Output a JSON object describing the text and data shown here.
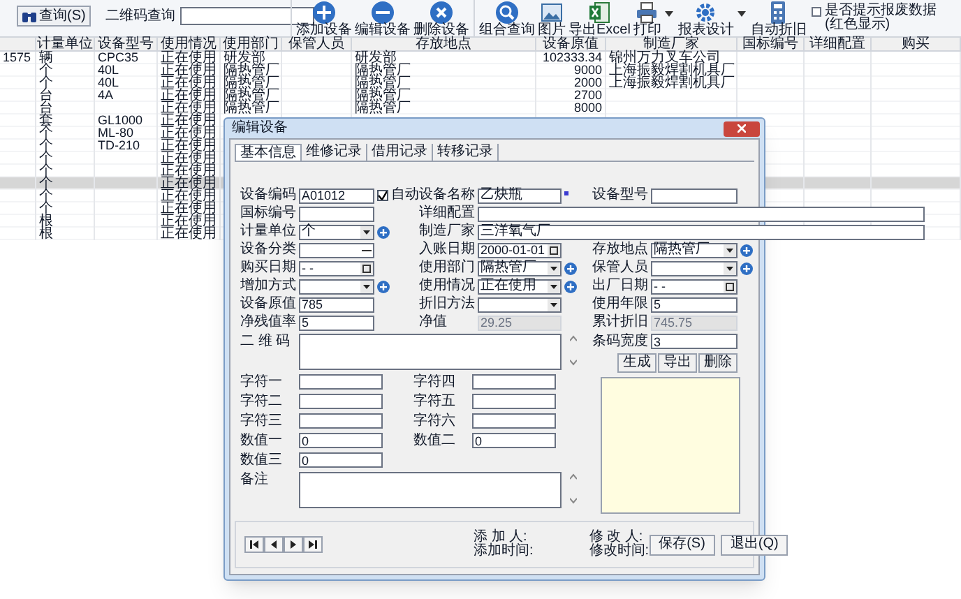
{
  "toolbar": {
    "query_button": "查询(S)",
    "qr_label": "二维码查询",
    "tools": [
      {
        "label": "添加设备",
        "kind": "add",
        "dropdown": false
      },
      {
        "label": "编辑设备",
        "kind": "edit",
        "dropdown": false
      },
      {
        "label": "删除设备",
        "kind": "delete",
        "dropdown": false
      },
      {
        "label": "组合查询",
        "kind": "search",
        "dropdown": false
      },
      {
        "label": "图片",
        "kind": "picture",
        "dropdown": false
      },
      {
        "label": "导出Excel",
        "kind": "excel",
        "dropdown": false
      },
      {
        "label": "打印",
        "kind": "print",
        "dropdown": true
      },
      {
        "label": "报表设计",
        "kind": "gear",
        "dropdown": true
      },
      {
        "label": "自动折旧",
        "kind": "calc",
        "dropdown": false
      }
    ],
    "warn_checkbox": {
      "label": "是否提示报废数据",
      "note": "(红色显示)",
      "checked": false
    }
  },
  "table": {
    "columns": [
      null,
      "计量单位",
      "设备型号",
      "使用情况",
      "使用部门",
      "保管人员",
      "存放地点",
      "设备原值",
      "制造厂家",
      "国标编号",
      "详细配置",
      "购买"
    ],
    "rows": [
      {
        "cells": [
          "1575",
          "辆",
          "CPC35",
          "正在使用",
          "研发部",
          null,
          "研发部",
          "102333.34",
          "锦州万力叉车公司",
          null,
          null,
          null
        ],
        "selected": false
      },
      {
        "cells": [
          null,
          "个",
          "40L",
          "正在使用",
          "隔热管厂",
          null,
          "隔热管厂",
          "9000",
          "上海振毅焊割机具厂",
          null,
          null,
          null
        ],
        "selected": false
      },
      {
        "cells": [
          null,
          "个",
          "40L",
          "正在使用",
          "隔热管厂",
          null,
          "隔热管厂",
          "2000",
          "上海振毅焊割机具厂",
          null,
          null,
          null
        ],
        "selected": false
      },
      {
        "cells": [
          null,
          "台",
          "4A",
          "正在使用",
          "隔热管厂",
          null,
          "隔热管厂",
          "2700",
          null,
          null,
          null,
          null
        ],
        "selected": false
      },
      {
        "cells": [
          null,
          "台",
          null,
          "正在使用",
          "隔热管厂",
          null,
          "隔热管厂",
          "8000",
          null,
          null,
          null,
          null
        ],
        "selected": false
      },
      {
        "cells": [
          null,
          "套",
          "GL1000",
          "正在使用",
          null,
          null,
          null,
          null,
          null,
          null,
          null,
          null
        ],
        "selected": false
      },
      {
        "cells": [
          null,
          "个",
          "ML-80",
          "正在使用",
          null,
          null,
          null,
          null,
          null,
          null,
          null,
          null
        ],
        "selected": false
      },
      {
        "cells": [
          null,
          "个",
          "TD-210",
          "正在使用",
          null,
          null,
          null,
          null,
          null,
          null,
          null,
          null
        ],
        "selected": false
      },
      {
        "cells": [
          null,
          "个",
          null,
          "正在使用",
          null,
          null,
          null,
          null,
          null,
          null,
          null,
          null
        ],
        "selected": false
      },
      {
        "cells": [
          null,
          "个",
          null,
          "正在使用",
          null,
          null,
          null,
          null,
          null,
          null,
          null,
          null
        ],
        "selected": false
      },
      {
        "cells": [
          null,
          "个",
          null,
          "正在使用",
          null,
          null,
          null,
          null,
          null,
          null,
          null,
          null
        ],
        "selected": true
      },
      {
        "cells": [
          null,
          "个",
          null,
          "正在使用",
          null,
          null,
          null,
          null,
          null,
          null,
          null,
          null
        ],
        "selected": false
      },
      {
        "cells": [
          null,
          "个",
          null,
          "正在使用",
          null,
          null,
          null,
          null,
          null,
          null,
          null,
          null
        ],
        "selected": false
      },
      {
        "cells": [
          null,
          "根",
          null,
          "正在使用",
          null,
          null,
          null,
          null,
          null,
          null,
          null,
          null
        ],
        "selected": false
      },
      {
        "cells": [
          null,
          "根",
          null,
          "正在使用",
          null,
          null,
          null,
          null,
          null,
          null,
          null,
          null
        ],
        "selected": false
      }
    ]
  },
  "dialog": {
    "title": "编辑设备",
    "tabs": [
      {
        "label": "基本信息",
        "selected": true
      },
      {
        "label": "维修记录",
        "selected": false
      },
      {
        "label": "借用记录",
        "selected": false
      },
      {
        "label": "转移记录",
        "selected": false
      }
    ],
    "form_rows": [
      [
        {
          "label": "设备编码",
          "value": "A01012",
          "kind": "text",
          "add": false,
          "disabled": false,
          "auto": {
            "label": "自动",
            "checked": true
          }
        },
        {
          "label": "设备名称",
          "value": "乙炔瓶",
          "kind": "text",
          "add": false,
          "disabled": false,
          "required": true
        },
        {
          "label": "设备型号",
          "kind": "text",
          "add": false,
          "disabled": false
        }
      ],
      [
        {
          "label": "国标编号",
          "kind": "text",
          "add": false,
          "disabled": false
        },
        {
          "label": "详细配置",
          "kind": "wide",
          "add": false,
          "disabled": false
        }
      ],
      [
        {
          "label": "计量单位",
          "value": "个",
          "kind": "combo",
          "add": true,
          "disabled": false
        },
        {
          "label": "制造厂家",
          "value": "三洋氧气厂",
          "kind": "wide",
          "add": false,
          "disabled": false
        }
      ],
      [
        {
          "label": "设备分类",
          "kind": "picker",
          "add": false,
          "disabled": false
        },
        {
          "label": "入账日期",
          "value": "2000-01-01",
          "kind": "date",
          "add": false,
          "disabled": false
        },
        {
          "label": "存放地点",
          "value": "隔热管厂",
          "kind": "combo",
          "add": true,
          "disabled": false
        }
      ],
      [
        {
          "label": "购买日期",
          "value": "- -",
          "kind": "date",
          "add": false,
          "disabled": false
        },
        {
          "label": "使用部门",
          "value": "隔热管厂",
          "kind": "combo",
          "add": true,
          "disabled": false
        },
        {
          "label": "保管人员",
          "kind": "combo",
          "add": true,
          "disabled": false
        }
      ],
      [
        {
          "label": "增加方式",
          "kind": "combo",
          "add": true,
          "disabled": false
        },
        {
          "label": "使用情况",
          "value": "正在使用",
          "kind": "combo",
          "add": true,
          "disabled": false
        },
        {
          "label": "出厂日期",
          "value": "- -",
          "kind": "date",
          "add": false,
          "disabled": false
        }
      ],
      [
        {
          "label": "设备原值",
          "value": "785",
          "kind": "text",
          "add": false,
          "disabled": false
        },
        {
          "label": "折旧方法",
          "kind": "combo",
          "add": false,
          "disabled": false
        },
        {
          "label": "使用年限",
          "value": "5",
          "kind": "text",
          "add": false,
          "disabled": false
        }
      ],
      [
        {
          "label": "净残值率",
          "value": "5",
          "kind": "text",
          "add": false,
          "disabled": false
        },
        {
          "label": "净值",
          "value": "29.25",
          "kind": "text",
          "add": false,
          "disabled": true
        },
        {
          "label": "累计折旧",
          "value": "745.75",
          "kind": "text",
          "add": false,
          "disabled": true
        }
      ]
    ],
    "qr_label": "二 维 码",
    "extra_fields": [
      {
        "label": "字符一"
      },
      {
        "label": "字符四"
      },
      {
        "label": "字符二"
      },
      {
        "label": "字符五"
      },
      {
        "label": "字符三"
      },
      {
        "label": "字符六"
      },
      {
        "label": "数值一",
        "value": "0"
      },
      {
        "label": "数值二",
        "value": "0"
      },
      {
        "label": "数值三",
        "value": "0"
      }
    ],
    "note_label": "备注",
    "barcode_width": {
      "label": "条码宽度",
      "value": "3"
    },
    "qr_buttons": [
      "生成",
      "导出",
      "删除"
    ],
    "footer": {
      "added_by": "添 加 人:",
      "added_time": "添加时间:",
      "modified_by": "修 改 人:",
      "modified_time": "修改时间:",
      "buttons": [
        "保存(S)",
        "退出(Q)"
      ]
    }
  }
}
